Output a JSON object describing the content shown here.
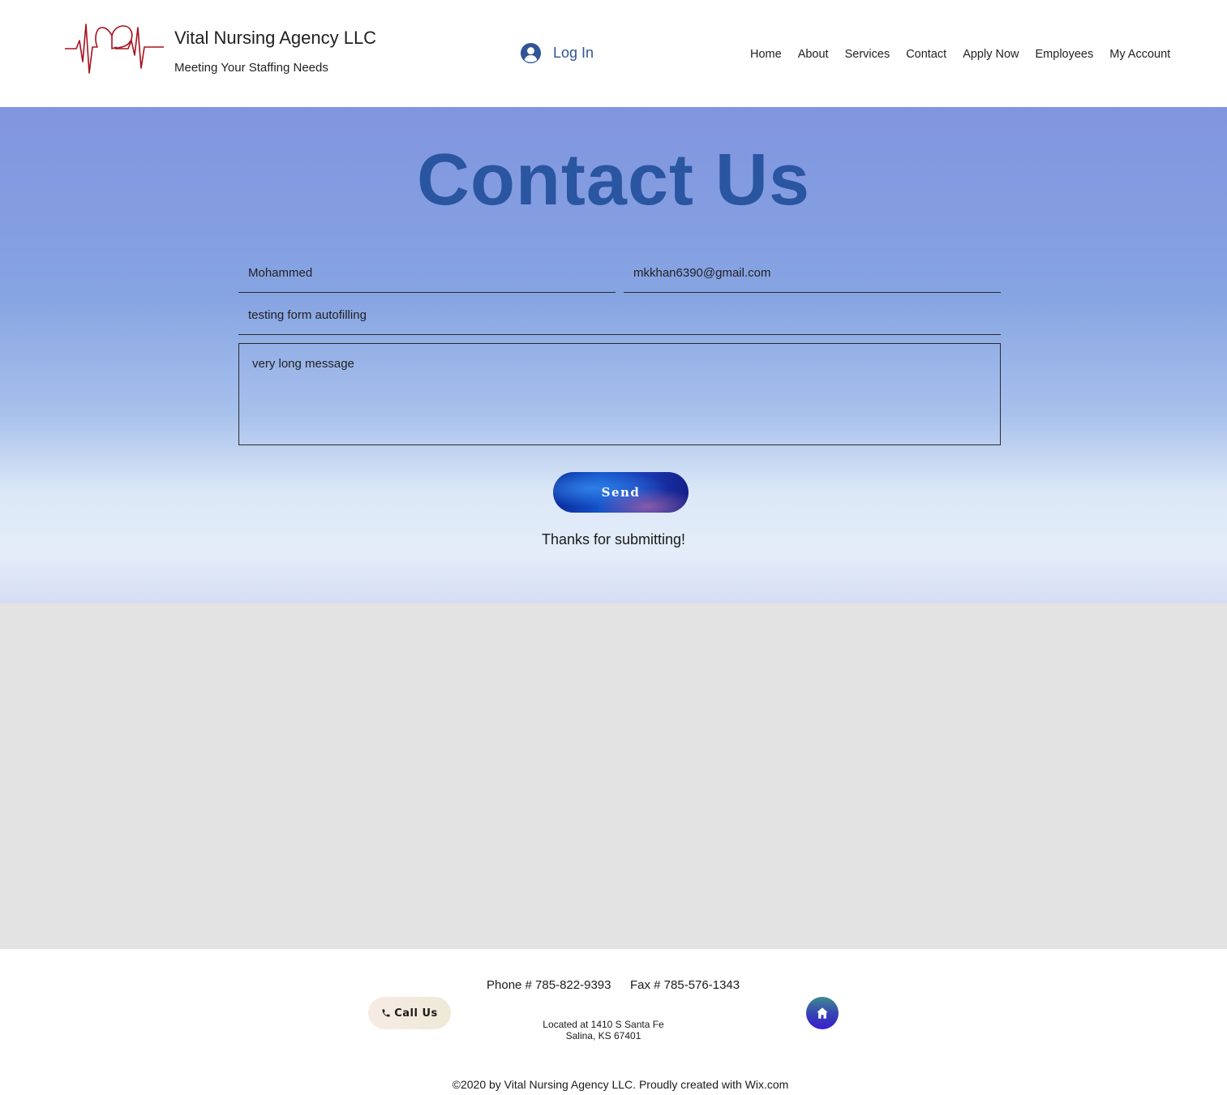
{
  "header": {
    "logo_icon": "heartbeat-heart-logo",
    "site_title": "Vital Nursing Agency LLC",
    "tagline": "Meeting Your Staffing Needs",
    "login_label": "Log In",
    "login_icon": "user-avatar-icon",
    "nav": [
      {
        "label": "Home"
      },
      {
        "label": "About"
      },
      {
        "label": "Services"
      },
      {
        "label": "Contact"
      },
      {
        "label": "Apply Now"
      },
      {
        "label": "Employees"
      },
      {
        "label": "My Account"
      }
    ]
  },
  "contact": {
    "title": "Contact Us",
    "name_value": "Mohammed",
    "email_value": "mkkhan6390@gmail.com",
    "subject_value": "testing form autofilling",
    "message_value": "very long message",
    "send_label": "Send",
    "thanks_message": "Thanks for submitting!"
  },
  "footer": {
    "phone": "Phone # 785-822-9393",
    "fax": "Fax # 785-576-1343",
    "call_label": "Call Us",
    "call_icon": "phone-icon",
    "address_line1": "Located at 1410 S Santa Fe",
    "address_line2": "Salina, KS 67401",
    "home_icon": "home-icon",
    "copyright": "©2020 by Vital Nursing Agency LLC. Proudly created with Wix.com"
  },
  "colors": {
    "accent_blue": "#2a55a0",
    "logo_red": "#a8101e",
    "grey_band": "#e3e3e3"
  }
}
